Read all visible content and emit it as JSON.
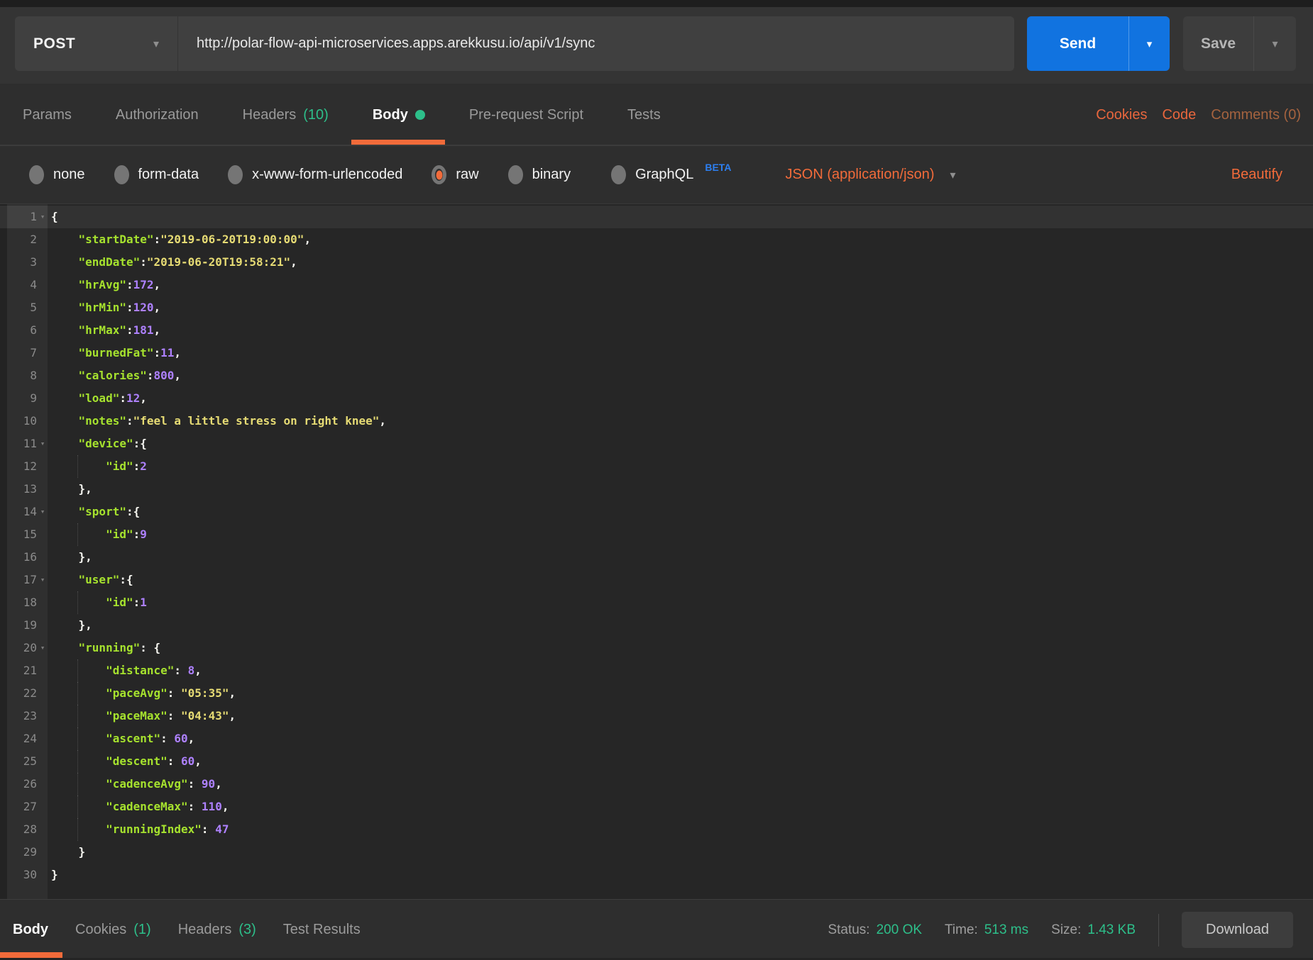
{
  "request_bar": {
    "method": "POST",
    "url": "http://polar-flow-api-microservices.apps.arekkusu.io/api/v1/sync",
    "send_label": "Send",
    "save_label": "Save"
  },
  "tabs": {
    "items": [
      {
        "label": "Params"
      },
      {
        "label": "Authorization"
      },
      {
        "label": "Headers",
        "count": "(10)"
      },
      {
        "label": "Body",
        "active": true,
        "dot": true
      },
      {
        "label": "Pre-request Script"
      },
      {
        "label": "Tests"
      }
    ],
    "links": {
      "cookies": "Cookies",
      "code": "Code",
      "comments": "Comments (0)"
    }
  },
  "body_options": {
    "radios": [
      {
        "label": "none"
      },
      {
        "label": "form-data"
      },
      {
        "label": "x-www-form-urlencoded"
      },
      {
        "label": "raw",
        "selected": true
      },
      {
        "label": "binary"
      },
      {
        "label": "GraphQL",
        "badge": "BETA"
      }
    ],
    "content_type": "JSON (application/json)",
    "beautify": "Beautify"
  },
  "editor": {
    "syntax_colors": {
      "key": "#a6e22e",
      "string": "#e6db74",
      "number": "#ae81ff",
      "punctuation": "#f8f8f2"
    },
    "lines": [
      {
        "n": 1,
        "fold": true,
        "active": true,
        "t": [
          [
            "p",
            "{"
          ]
        ]
      },
      {
        "n": 2,
        "t": [
          [
            "w",
            "    "
          ],
          [
            "k",
            "\"startDate\""
          ],
          [
            "p",
            ":"
          ],
          [
            "s",
            "\"2019-06-20T19:00:00\""
          ],
          [
            "p",
            ","
          ]
        ]
      },
      {
        "n": 3,
        "t": [
          [
            "w",
            "    "
          ],
          [
            "k",
            "\"endDate\""
          ],
          [
            "p",
            ":"
          ],
          [
            "s",
            "\"2019-06-20T19:58:21\""
          ],
          [
            "p",
            ","
          ]
        ]
      },
      {
        "n": 4,
        "t": [
          [
            "w",
            "    "
          ],
          [
            "k",
            "\"hrAvg\""
          ],
          [
            "p",
            ":"
          ],
          [
            "d",
            "172"
          ],
          [
            "p",
            ","
          ]
        ]
      },
      {
        "n": 5,
        "t": [
          [
            "w",
            "    "
          ],
          [
            "k",
            "\"hrMin\""
          ],
          [
            "p",
            ":"
          ],
          [
            "d",
            "120"
          ],
          [
            "p",
            ","
          ]
        ]
      },
      {
        "n": 6,
        "t": [
          [
            "w",
            "    "
          ],
          [
            "k",
            "\"hrMax\""
          ],
          [
            "p",
            ":"
          ],
          [
            "d",
            "181"
          ],
          [
            "p",
            ","
          ]
        ]
      },
      {
        "n": 7,
        "t": [
          [
            "w",
            "    "
          ],
          [
            "k",
            "\"burnedFat\""
          ],
          [
            "p",
            ":"
          ],
          [
            "d",
            "11"
          ],
          [
            "p",
            ","
          ]
        ]
      },
      {
        "n": 8,
        "t": [
          [
            "w",
            "    "
          ],
          [
            "k",
            "\"calories\""
          ],
          [
            "p",
            ":"
          ],
          [
            "d",
            "800"
          ],
          [
            "p",
            ","
          ]
        ]
      },
      {
        "n": 9,
        "t": [
          [
            "w",
            "    "
          ],
          [
            "k",
            "\"load\""
          ],
          [
            "p",
            ":"
          ],
          [
            "d",
            "12"
          ],
          [
            "p",
            ","
          ]
        ]
      },
      {
        "n": 10,
        "t": [
          [
            "w",
            "    "
          ],
          [
            "k",
            "\"notes\""
          ],
          [
            "p",
            ":"
          ],
          [
            "s",
            "\"feel a little stress on right knee\""
          ],
          [
            "p",
            ","
          ]
        ]
      },
      {
        "n": 11,
        "fold": true,
        "t": [
          [
            "w",
            "    "
          ],
          [
            "k",
            "\"device\""
          ],
          [
            "p",
            ":{"
          ]
        ]
      },
      {
        "n": 12,
        "guide": true,
        "t": [
          [
            "w",
            "        "
          ],
          [
            "k",
            "\"id\""
          ],
          [
            "p",
            ":"
          ],
          [
            "d",
            "2"
          ]
        ]
      },
      {
        "n": 13,
        "t": [
          [
            "w",
            "    "
          ],
          [
            "p",
            "},"
          ]
        ]
      },
      {
        "n": 14,
        "fold": true,
        "t": [
          [
            "w",
            "    "
          ],
          [
            "k",
            "\"sport\""
          ],
          [
            "p",
            ":{"
          ]
        ]
      },
      {
        "n": 15,
        "guide": true,
        "t": [
          [
            "w",
            "        "
          ],
          [
            "k",
            "\"id\""
          ],
          [
            "p",
            ":"
          ],
          [
            "d",
            "9"
          ]
        ]
      },
      {
        "n": 16,
        "t": [
          [
            "w",
            "    "
          ],
          [
            "p",
            "},"
          ]
        ]
      },
      {
        "n": 17,
        "fold": true,
        "t": [
          [
            "w",
            "    "
          ],
          [
            "k",
            "\"user\""
          ],
          [
            "p",
            ":{"
          ]
        ]
      },
      {
        "n": 18,
        "guide": true,
        "t": [
          [
            "w",
            "        "
          ],
          [
            "k",
            "\"id\""
          ],
          [
            "p",
            ":"
          ],
          [
            "d",
            "1"
          ]
        ]
      },
      {
        "n": 19,
        "t": [
          [
            "w",
            "    "
          ],
          [
            "p",
            "},"
          ]
        ]
      },
      {
        "n": 20,
        "fold": true,
        "t": [
          [
            "w",
            "    "
          ],
          [
            "k",
            "\"running\""
          ],
          [
            "p",
            ": {"
          ]
        ]
      },
      {
        "n": 21,
        "guide": true,
        "t": [
          [
            "w",
            "        "
          ],
          [
            "k",
            "\"distance\""
          ],
          [
            "p",
            ": "
          ],
          [
            "d",
            "8"
          ],
          [
            "p",
            ","
          ]
        ]
      },
      {
        "n": 22,
        "guide": true,
        "t": [
          [
            "w",
            "        "
          ],
          [
            "k",
            "\"paceAvg\""
          ],
          [
            "p",
            ": "
          ],
          [
            "s",
            "\"05:35\""
          ],
          [
            "p",
            ","
          ]
        ]
      },
      {
        "n": 23,
        "guide": true,
        "t": [
          [
            "w",
            "        "
          ],
          [
            "k",
            "\"paceMax\""
          ],
          [
            "p",
            ": "
          ],
          [
            "s",
            "\"04:43\""
          ],
          [
            "p",
            ","
          ]
        ]
      },
      {
        "n": 24,
        "guide": true,
        "t": [
          [
            "w",
            "        "
          ],
          [
            "k",
            "\"ascent\""
          ],
          [
            "p",
            ": "
          ],
          [
            "d",
            "60"
          ],
          [
            "p",
            ","
          ]
        ]
      },
      {
        "n": 25,
        "guide": true,
        "t": [
          [
            "w",
            "        "
          ],
          [
            "k",
            "\"descent\""
          ],
          [
            "p",
            ": "
          ],
          [
            "d",
            "60"
          ],
          [
            "p",
            ","
          ]
        ]
      },
      {
        "n": 26,
        "guide": true,
        "t": [
          [
            "w",
            "        "
          ],
          [
            "k",
            "\"cadenceAvg\""
          ],
          [
            "p",
            ": "
          ],
          [
            "d",
            "90"
          ],
          [
            "p",
            ","
          ]
        ]
      },
      {
        "n": 27,
        "guide": true,
        "t": [
          [
            "w",
            "        "
          ],
          [
            "k",
            "\"cadenceMax\""
          ],
          [
            "p",
            ": "
          ],
          [
            "d",
            "110"
          ],
          [
            "p",
            ","
          ]
        ]
      },
      {
        "n": 28,
        "guide": true,
        "t": [
          [
            "w",
            "        "
          ],
          [
            "k",
            "\"runningIndex\""
          ],
          [
            "p",
            ": "
          ],
          [
            "d",
            "47"
          ]
        ]
      },
      {
        "n": 29,
        "t": [
          [
            "w",
            "    "
          ],
          [
            "p",
            "}"
          ]
        ]
      },
      {
        "n": 30,
        "t": [
          [
            "p",
            "}"
          ]
        ]
      }
    ]
  },
  "response_bar": {
    "tabs": [
      {
        "label": "Body",
        "active": true
      },
      {
        "label": "Cookies",
        "count": "(1)"
      },
      {
        "label": "Headers",
        "count": "(3)"
      },
      {
        "label": "Test Results"
      }
    ],
    "status_label": "Status:",
    "status_value": "200 OK",
    "time_label": "Time:",
    "time_value": "513 ms",
    "size_label": "Size:",
    "size_value": "1.43 KB",
    "download_label": "Download"
  },
  "colors": {
    "accent_orange": "#f26b3a",
    "status_green": "#2dbf8a",
    "send_blue": "#1173e0",
    "beta_blue": "#2d7ff0",
    "comments_muted": "#a5633f"
  }
}
